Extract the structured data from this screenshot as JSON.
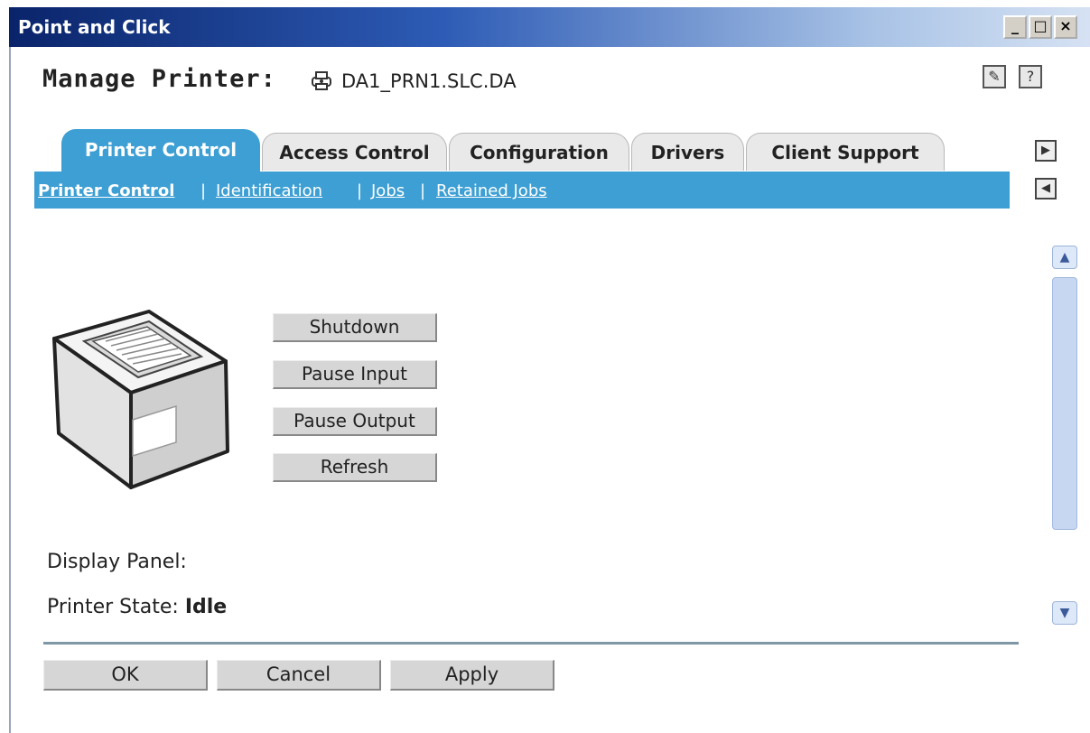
{
  "window": {
    "title": "Point and Click"
  },
  "header": {
    "label": "Manage Printer:",
    "printer_name": "DA1_PRN1.SLC.DA"
  },
  "tabs": [
    {
      "label": "Printer Control",
      "active": true
    },
    {
      "label": "Access Control",
      "active": false
    },
    {
      "label": "Configuration",
      "active": false
    },
    {
      "label": "Drivers",
      "active": false
    },
    {
      "label": "Client Support",
      "active": false
    }
  ],
  "subnav": [
    {
      "label": "Printer Control",
      "active": true
    },
    {
      "label": "Identification"
    },
    {
      "label": "Jobs"
    },
    {
      "label": "Retained Jobs"
    }
  ],
  "subnav_separator": "|",
  "actions": {
    "shutdown": "Shutdown",
    "pause_input": "Pause Input",
    "pause_output": "Pause Output",
    "refresh": "Refresh"
  },
  "status": {
    "display_panel_label": "Display Panel:",
    "printer_state_label": "Printer State:",
    "printer_state_value": "Idle"
  },
  "footer": {
    "ok": "OK",
    "cancel": "Cancel",
    "apply": "Apply"
  },
  "colors": {
    "accent": "#3d9fd3",
    "titlebar": "#0a246a"
  }
}
